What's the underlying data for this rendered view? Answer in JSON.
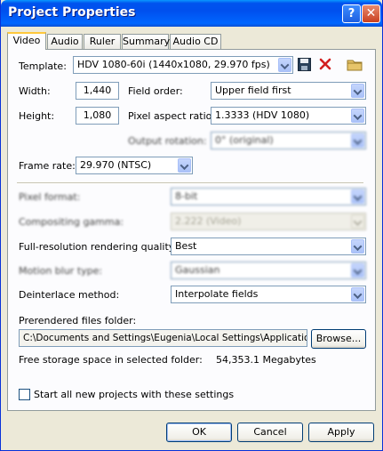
{
  "window": {
    "title": "Project Properties",
    "help_glyph": "?",
    "close_glyph": "✕"
  },
  "tabs": [
    "Video",
    "Audio",
    "Ruler",
    "Summary",
    "Audio CD"
  ],
  "video": {
    "template_label": "Template:",
    "template_value": "HDV 1080-60i (1440x1080, 29.970 fps)",
    "width_label": "Width:",
    "width_value": "1,440",
    "height_label": "Height:",
    "height_value": "1,080",
    "field_order_label": "Field order:",
    "field_order_value": "Upper field first",
    "pixel_aspect_label": "Pixel aspect ratio:",
    "pixel_aspect_value": "1.3333 (HDV 1080)",
    "output_rotation_label": "Output rotation:",
    "output_rotation_value": "0° (original)",
    "frame_rate_label": "Frame rate:",
    "frame_rate_value": "29.970 (NTSC)",
    "pixel_format_label": "Pixel format:",
    "pixel_format_value": "8-bit",
    "compositing_gamma_label": "Compositing gamma:",
    "compositing_gamma_value": "2.222 (Video)",
    "rendering_quality_label": "Full-resolution rendering quality:",
    "rendering_quality_value": "Best",
    "motion_blur_label": "Motion blur type:",
    "motion_blur_value": "Gaussian",
    "deinterlace_label": "Deinterlace method:",
    "deinterlace_value": "Interpolate fields",
    "prerendered_label": "Prerendered files folder:",
    "prerendered_path": "C:\\Documents and Settings\\Eugenia\\Local Settings\\Application Da",
    "browse_label": "Browse...",
    "free_space_label": "Free storage space in selected folder:",
    "free_space_value": "54,353.1 Megabytes",
    "start_all_label": "Start all new projects with these settings",
    "start_all_checked": false
  },
  "buttons": {
    "ok": "OK",
    "cancel": "Cancel",
    "apply": "Apply"
  },
  "icons": {
    "save": "save-icon",
    "delete": "delete-icon",
    "folder": "folder-icon"
  },
  "colors": {
    "titlebar": "#0058ee",
    "face": "#ece9d8",
    "panel": "#fcfcfe",
    "delete_red": "#d21f1f"
  }
}
